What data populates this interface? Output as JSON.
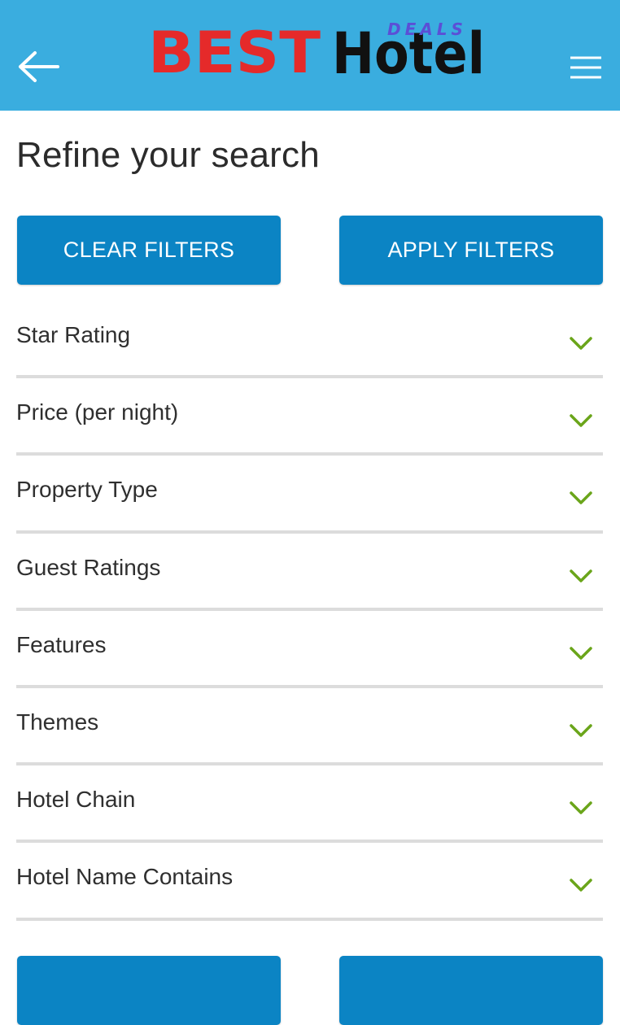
{
  "header": {
    "logo_best": "BEST",
    "logo_hotel": "Hotel",
    "logo_deals": "DEALS",
    "back_icon": "arrow-left-icon",
    "menu_icon": "hamburger-menu-icon",
    "background_color": "#3aaddf"
  },
  "page": {
    "title": "Refine your search"
  },
  "actions": {
    "clear_label": "CLEAR FILTERS",
    "apply_label": "APPLY FILTERS",
    "button_color": "#0b84c4"
  },
  "filters": [
    {
      "label": "Star Rating"
    },
    {
      "label": "Price (per night)"
    },
    {
      "label": "Property Type"
    },
    {
      "label": "Guest Ratings"
    },
    {
      "label": "Features"
    },
    {
      "label": "Themes"
    },
    {
      "label": "Hotel Chain"
    },
    {
      "label": "Hotel Name Contains"
    }
  ],
  "chevron_color": "#6aa51a"
}
